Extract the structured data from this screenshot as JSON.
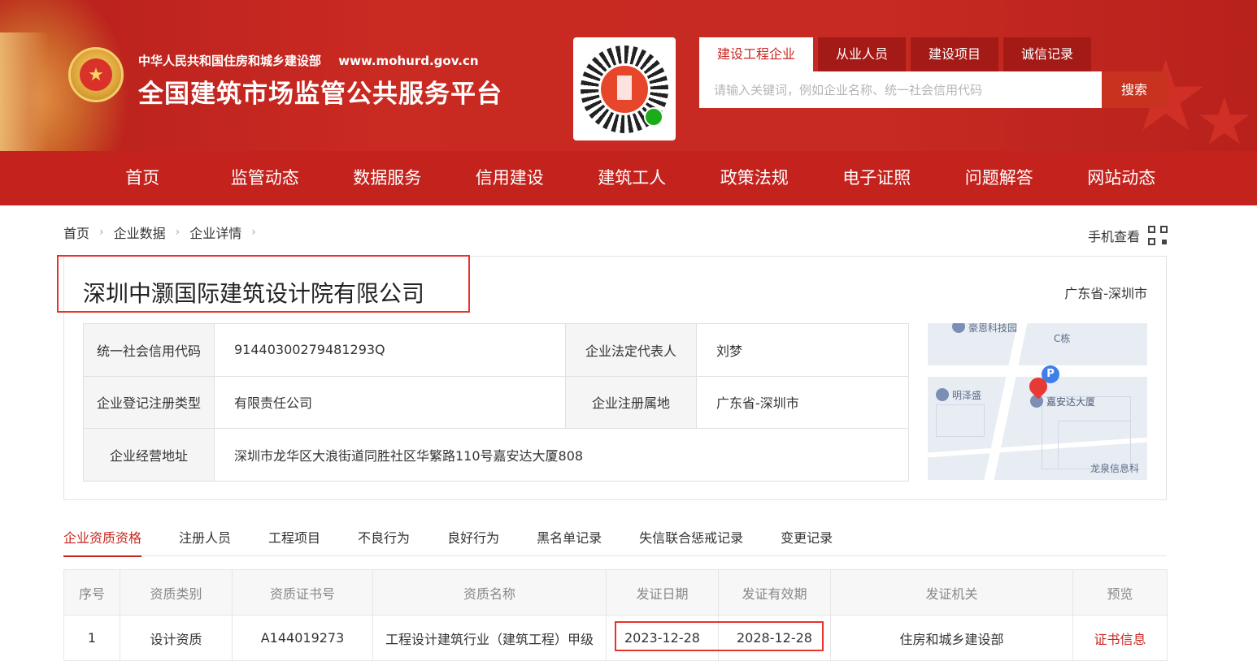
{
  "header": {
    "ministry": "中华人民共和国住房和城乡建设部",
    "url": "www.mohurd.gov.cn",
    "title": "全国建筑市场监管公共服务平台"
  },
  "search": {
    "tabs": [
      "建设工程企业",
      "从业人员",
      "建设项目",
      "诚信记录"
    ],
    "active_tab": 0,
    "placeholder": "请输入关键词，例如企业名称、统一社会信用代码",
    "value": "",
    "button": "搜索"
  },
  "nav": [
    "首页",
    "监管动态",
    "数据服务",
    "信用建设",
    "建筑工人",
    "政策法规",
    "电子证照",
    "问题解答",
    "网站动态"
  ],
  "breadcrumb": [
    "首页",
    "企业数据",
    "企业详情"
  ],
  "mobile_view": "手机查看",
  "company": {
    "name": "深圳中灏国际建筑设计院有限公司",
    "region": "广东省-深圳市",
    "info": {
      "credit_code_label": "统一社会信用代码",
      "credit_code": "91440300279481293Q",
      "legal_rep_label": "企业法定代表人",
      "legal_rep": "刘梦",
      "reg_type_label": "企业登记注册类型",
      "reg_type": "有限责任公司",
      "reg_place_label": "企业注册属地",
      "reg_place": "广东省-深圳市",
      "address_label": "企业经营地址",
      "address": "深圳市龙华区大浪街道同胜社区华繁路110号嘉安达大厦808"
    }
  },
  "map": {
    "labels": [
      "豪恩科技园",
      "C栋",
      "明泽盛",
      "嘉安达大厦",
      "龙泉信息科"
    ],
    "parking": "P"
  },
  "tabs": [
    "企业资质资格",
    "注册人员",
    "工程项目",
    "不良行为",
    "良好行为",
    "黑名单记录",
    "失信联合惩戒记录",
    "变更记录"
  ],
  "active_tab": 0,
  "qualifications": {
    "headers": [
      "序号",
      "资质类别",
      "资质证书号",
      "资质名称",
      "发证日期",
      "发证有效期",
      "发证机关",
      "预览"
    ],
    "rows": [
      {
        "index": "1",
        "category": "设计资质",
        "cert_no": "A144019273",
        "name": "工程设计建筑行业（建筑工程）甲级",
        "issue_date": "2023-12-28",
        "valid_until": "2028-12-28",
        "authority": "住房和城乡建设部",
        "preview": "证书信息"
      }
    ]
  },
  "colors": {
    "header_red": "#c62a22",
    "nav_red": "#c4221d",
    "accent_red": "#c8271f",
    "highlight_border": "#e8322b"
  }
}
